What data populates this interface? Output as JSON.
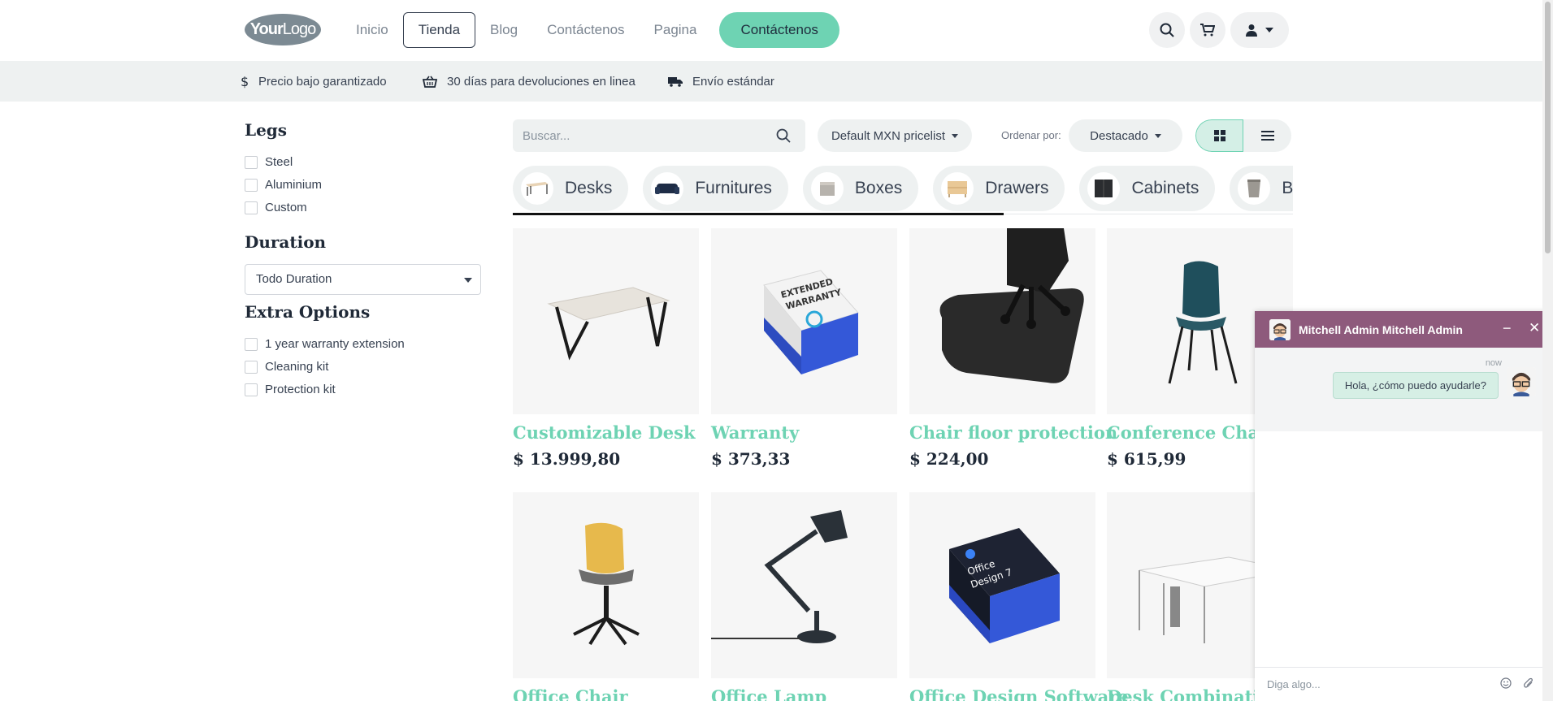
{
  "header": {
    "logo_text_bold": "Your",
    "logo_text_light": "Logo",
    "nav": [
      {
        "label": "Inicio"
      },
      {
        "label": "Tienda"
      },
      {
        "label": "Blog"
      },
      {
        "label": "Contáctenos"
      },
      {
        "label": "Pagina"
      }
    ],
    "cta_label": "Contáctenos"
  },
  "infobar": {
    "items": [
      {
        "icon": "dollar-icon",
        "label": "Precio bajo garantizado"
      },
      {
        "icon": "basket-icon",
        "label": "30 días para devoluciones en linea"
      },
      {
        "icon": "truck-icon",
        "label": "Envío estándar"
      }
    ]
  },
  "sidebar": {
    "legs_title": "Legs",
    "legs_options": [
      {
        "label": "Steel"
      },
      {
        "label": "Aluminium"
      },
      {
        "label": "Custom"
      }
    ],
    "duration_title": "Duration",
    "duration_selected": "Todo Duration",
    "extra_title": "Extra Options",
    "extra_options": [
      {
        "label": "1 year warranty extension"
      },
      {
        "label": "Cleaning kit"
      },
      {
        "label": "Protection kit"
      }
    ]
  },
  "toolbar": {
    "search_placeholder": "Buscar...",
    "pricelist": "Default MXN pricelist",
    "sort_label": "Ordenar por:",
    "sort_value": "Destacado"
  },
  "categories": [
    {
      "label": "Desks"
    },
    {
      "label": "Furnitures"
    },
    {
      "label": "Boxes"
    },
    {
      "label": "Drawers"
    },
    {
      "label": "Cabinets"
    },
    {
      "label": "Bins"
    }
  ],
  "products": [
    {
      "name": "Customizable Desk",
      "price": "$ 13.999,80"
    },
    {
      "name": "Warranty",
      "price": "$ 373,33"
    },
    {
      "name": "Chair floor protection",
      "price": "$ 224,00"
    },
    {
      "name": "Conference Chair",
      "price": "$ 615,99"
    },
    {
      "name": "Office Chair"
    },
    {
      "name": "Office Lamp"
    },
    {
      "name": "Office Design Software"
    },
    {
      "name": "Desk Combination"
    }
  ],
  "product_labels": {
    "warranty_box_line1": "EXTENDED",
    "warranty_box_line2": "WARRANTY",
    "software_box_line1": "Office",
    "software_box_line2": "Design 7"
  },
  "chat": {
    "title": "Mitchell Admin Mitchell Admin",
    "time": "now",
    "message": "Hola, ¿cómo puedo ayudarle?",
    "input_placeholder": "Diga algo...",
    "header_color": "#8e5a7c"
  },
  "colors": {
    "accent": "#6ed3b3",
    "infobar_bg": "#eef1f1"
  }
}
